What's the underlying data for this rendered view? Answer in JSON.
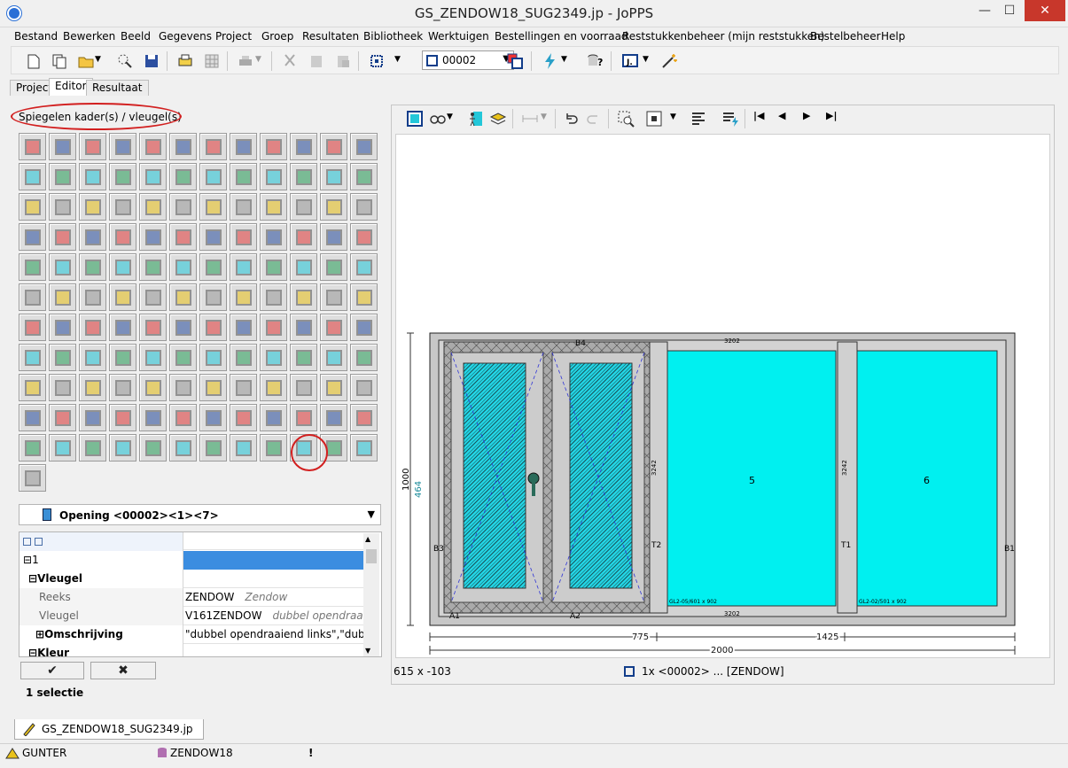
{
  "window": {
    "title": "GS_ZENDOW18_SUG2349.jp - JoPPS",
    "minimize": "—",
    "maximize": "☐",
    "close": "✕"
  },
  "menu": [
    "Bestand",
    "Bewerken",
    "Beeld",
    "Gegevens",
    "Project",
    "Groep",
    "Resultaten",
    "Bibliotheek",
    "Werktuigen",
    "Bestellingen en voorraad",
    "Reststukkenbeheer (mijn reststukken)",
    "Bestelbeheer",
    "Help"
  ],
  "toolbar": {
    "group_value": "00002"
  },
  "tabs": [
    "Project",
    "Editor",
    "Resultaat"
  ],
  "editor": {
    "panel_title": "Spiegelen kader(s) / vleugel(s)",
    "opening_value": "Opening <00002><1><7>",
    "props": {
      "root": "1",
      "section_vleugel": "Vleugel",
      "reeks_label": "Reeks",
      "reeks_value": "ZENDOW",
      "reeks_desc": "Zendow",
      "vleugel_label": "Vleugel",
      "vleugel_value": "V161ZENDOW",
      "vleugel_desc": "dubbel opendraaiend",
      "omschrijving_label": "Omschrijving",
      "omschrijving_value": "\"dubbel opendraaiend links\",\"dubbel",
      "section_kleur": "Kleur"
    },
    "ok_label": "✔",
    "cancel_label": "✖",
    "selection": "1 selectie"
  },
  "drawing": {
    "dim_height": "1000",
    "dim_sub": "464",
    "dim_left_width": "775",
    "dim_right_width": "1425",
    "dim_total": "2000",
    "cursor_pos": "615 x -103",
    "status_element": "1x <00002> ... [ZENDOW]",
    "labels": {
      "p5": "5",
      "p6": "6",
      "b1": "B1",
      "b3": "B3",
      "b4": "B4",
      "t1": "T1",
      "t2": "T2",
      "dim3202a": "3202",
      "dim3202b": "3202",
      "dim3242a": "3242",
      "dim3242b": "3242",
      "a1": "A1",
      "a2": "A2",
      "glass1": "GL2-05/601 x 902",
      "glass2": "GL2-02/501 x 902"
    }
  },
  "documents": {
    "tab": "GS_ZENDOW18_SUG2349.jp"
  },
  "status": {
    "user": "GUNTER",
    "database": "ZENDOW18",
    "alert": "!"
  }
}
